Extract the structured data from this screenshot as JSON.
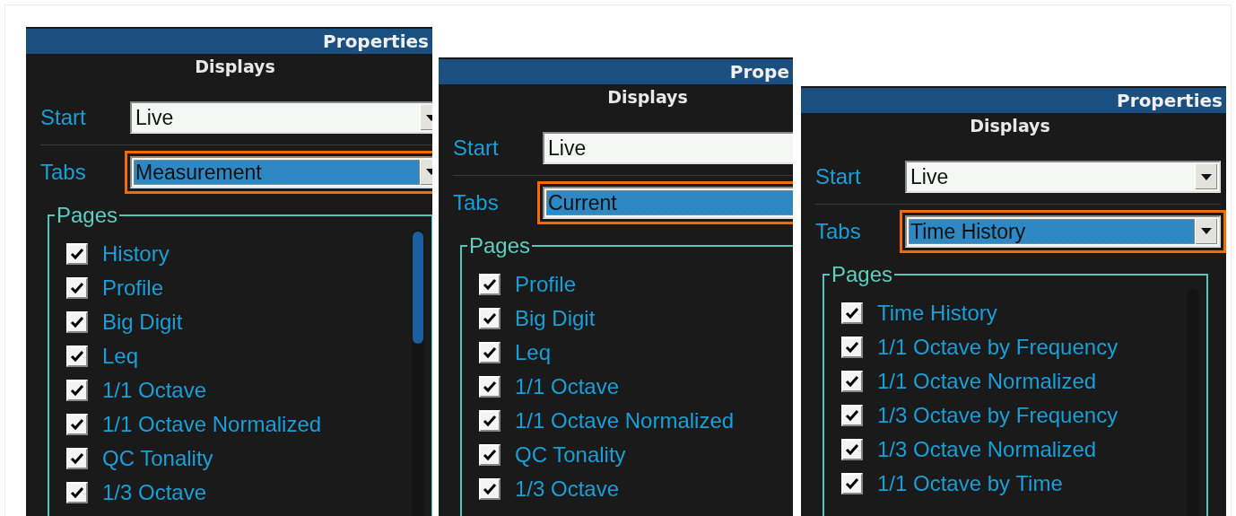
{
  "windows": [
    {
      "title": "Properties",
      "heading": "Displays",
      "fields": [
        {
          "label": "Start",
          "value": "Live",
          "highlighted": false
        },
        {
          "label": "Tabs",
          "value": "Measurement",
          "highlighted": true
        }
      ],
      "pages": {
        "legend": "Pages",
        "items": [
          {
            "label": "History",
            "checked": true
          },
          {
            "label": "Profile",
            "checked": true
          },
          {
            "label": "Big Digit",
            "checked": true
          },
          {
            "label": "Leq",
            "checked": true
          },
          {
            "label": "1/1 Octave",
            "checked": true
          },
          {
            "label": "1/1 Octave Normalized",
            "checked": true
          },
          {
            "label": "QC Tonality",
            "checked": true
          },
          {
            "label": "1/3 Octave",
            "checked": true
          }
        ]
      }
    },
    {
      "title": "Prope",
      "heading": "Displays",
      "fields": [
        {
          "label": "Start",
          "value": "Live",
          "highlighted": false
        },
        {
          "label": "Tabs",
          "value": "Current",
          "highlighted": true
        }
      ],
      "pages": {
        "legend": "Pages",
        "items": [
          {
            "label": "Profile",
            "checked": true
          },
          {
            "label": "Big Digit",
            "checked": true
          },
          {
            "label": "Leq",
            "checked": true
          },
          {
            "label": "1/1 Octave",
            "checked": true
          },
          {
            "label": "1/1 Octave Normalized",
            "checked": true
          },
          {
            "label": "QC Tonality",
            "checked": true
          },
          {
            "label": "1/3 Octave",
            "checked": true
          }
        ]
      }
    },
    {
      "title": "Properties",
      "heading": "Displays",
      "fields": [
        {
          "label": "Start",
          "value": "Live",
          "highlighted": false
        },
        {
          "label": "Tabs",
          "value": "Time History",
          "highlighted": true
        }
      ],
      "pages": {
        "legend": "Pages",
        "items": [
          {
            "label": "Time History",
            "checked": true
          },
          {
            "label": "1/1 Octave by Frequency",
            "checked": true
          },
          {
            "label": "1/1 Octave Normalized",
            "checked": true
          },
          {
            "label": "1/3 Octave by Frequency",
            "checked": true
          },
          {
            "label": "1/3 Octave Normalized",
            "checked": true
          },
          {
            "label": "1/1 Octave by Time",
            "checked": true
          }
        ]
      }
    }
  ]
}
